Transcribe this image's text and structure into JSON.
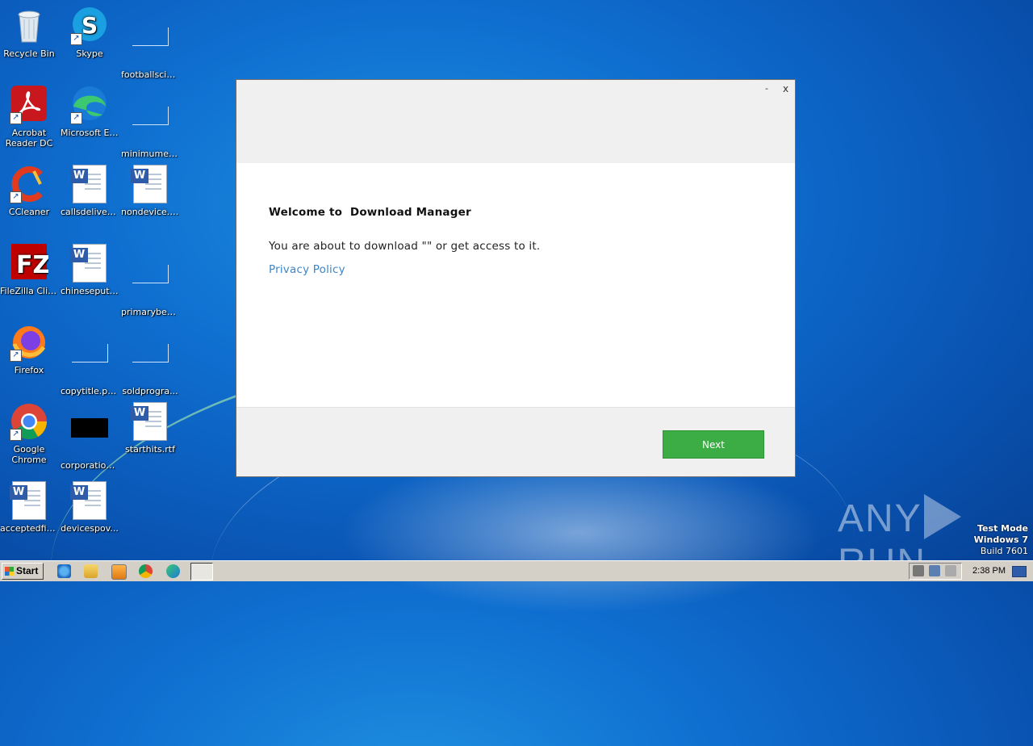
{
  "desktop": {
    "icons": [
      {
        "label": "Recycle Bin"
      },
      {
        "label": "Skype"
      },
      {
        "label": "footballscie..."
      },
      {
        "label": "Acrobat Reader DC"
      },
      {
        "label": "Microsoft Edge"
      },
      {
        "label": "minimumeit..."
      },
      {
        "label": "CCleaner"
      },
      {
        "label": "callsdelivery..."
      },
      {
        "label": "nondevice.rtf"
      },
      {
        "label": "FileZilla Client"
      },
      {
        "label": "chineseput.rtf"
      },
      {
        "label": "primarybec..."
      },
      {
        "label": "Firefox"
      },
      {
        "label": "copytitle.png"
      },
      {
        "label": "soldprogra..."
      },
      {
        "label": "Google Chrome"
      },
      {
        "label": "corporation..."
      },
      {
        "label": "starthits.rtf"
      },
      {
        "label": "acceptedfin..."
      },
      {
        "label": "devicespov..."
      }
    ]
  },
  "dialog": {
    "minimize": "-",
    "close": "x",
    "welcome": "Welcome to  Download Manager",
    "about": "You are about to download \"\" or get access to it.",
    "privacy": "Privacy Policy",
    "next": "Next"
  },
  "watermark": {
    "left": "ANY",
    "right": "RUN"
  },
  "os": {
    "line1": "Test Mode",
    "line2": "Windows 7",
    "line3": "Build 7601"
  },
  "taskbar": {
    "start": "Start",
    "clock": "2:38 PM"
  }
}
